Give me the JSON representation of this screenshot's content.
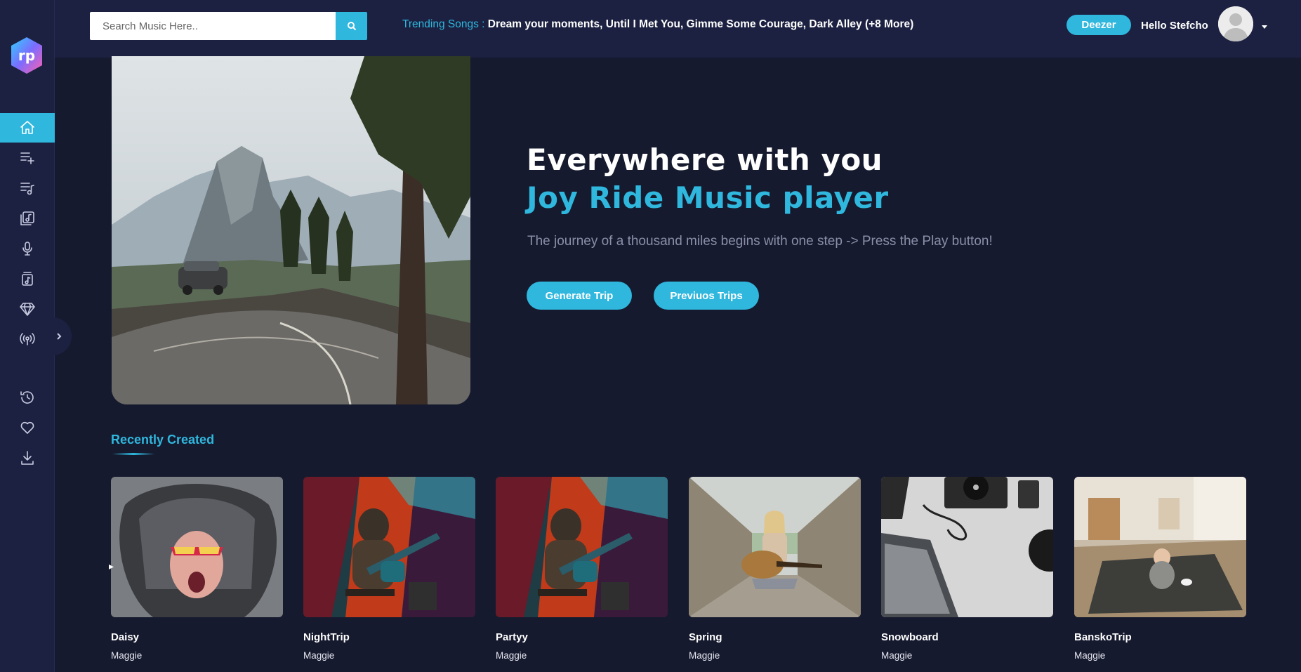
{
  "app": {
    "logo_text": "rp"
  },
  "header": {
    "search_placeholder": "Search Music Here..",
    "trending_label": "Trending Songs :",
    "trending_songs": "Dream your moments, Until I Met You, Gimme Some Courage, Dark Alley (+8 More)",
    "deezer_label": "Deezer",
    "greeting": "Hello Stefcho"
  },
  "sidebar": {
    "items": [
      {
        "icon": "home-icon",
        "active": true
      },
      {
        "icon": "add-playlist-icon"
      },
      {
        "icon": "playlist-icon"
      },
      {
        "icon": "album-icon"
      },
      {
        "icon": "microphone-icon"
      },
      {
        "icon": "music-note-icon"
      },
      {
        "icon": "diamond-icon"
      },
      {
        "icon": "broadcast-icon"
      },
      {
        "icon": "history-icon"
      },
      {
        "icon": "heart-icon"
      },
      {
        "icon": "download-icon"
      }
    ]
  },
  "hero": {
    "title_line1": "Everywhere with you",
    "title_line2": "Joy Ride Music player",
    "subtitle": "The journey of a thousand miles begins with one step -> Press the Play button!",
    "primary_button": "Generate Trip",
    "secondary_button": "Previuos Trips"
  },
  "recent": {
    "title": "Recently Created",
    "cards": [
      {
        "name": "Daisy",
        "artist": "Maggie"
      },
      {
        "name": "NightTrip",
        "artist": "Maggie"
      },
      {
        "name": "Partyy",
        "artist": "Maggie"
      },
      {
        "name": "Spring",
        "artist": "Maggie"
      },
      {
        "name": "Snowboard",
        "artist": "Maggie"
      },
      {
        "name": "BanskoTrip",
        "artist": "Maggie"
      }
    ]
  },
  "colors": {
    "accent": "#2fb7de",
    "background": "#161a2e",
    "panel": "#1c2141"
  }
}
